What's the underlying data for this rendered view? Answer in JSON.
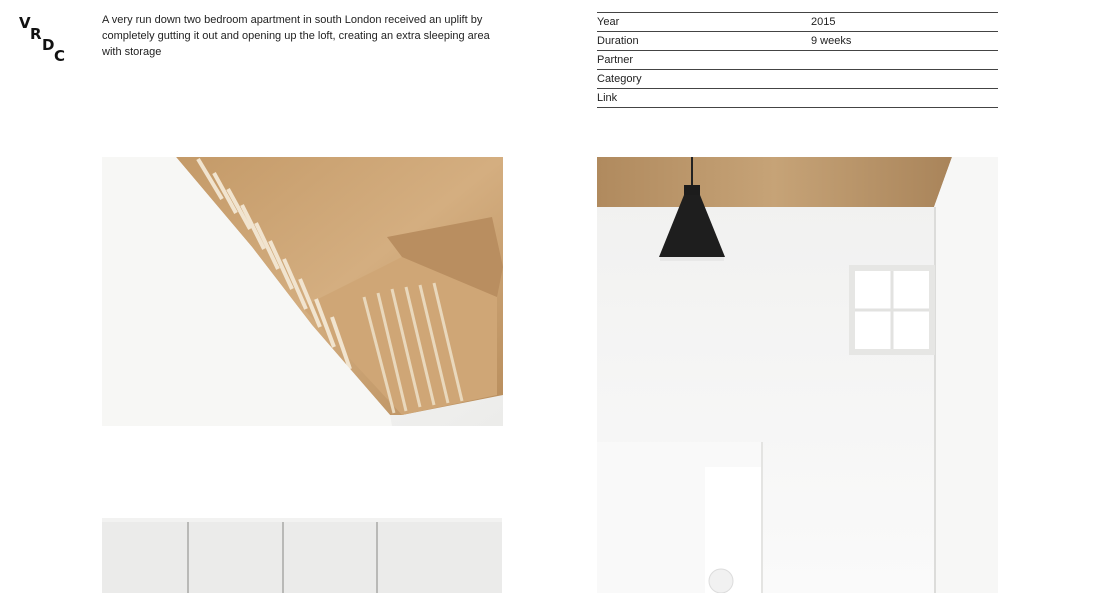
{
  "brand": {
    "logo_letters": [
      "V",
      "R",
      "D",
      "C"
    ]
  },
  "project": {
    "description": "A very run down two bedroom apartment in south London received an uplift by completely gutting it out and opening up the loft, creating an extra sleeping area with storage"
  },
  "meta": [
    {
      "label": "Year",
      "value": "2015"
    },
    {
      "label": "Duration",
      "value": "9 weeks"
    },
    {
      "label": "Partner",
      "value": ""
    },
    {
      "label": "Category",
      "value": ""
    },
    {
      "label": "Link",
      "value": ""
    }
  ],
  "gallery": [
    {
      "subject": "plywood-staircase-photo"
    },
    {
      "subject": "pendant-lamp-loft-photo"
    },
    {
      "subject": "storage-wall-photo"
    }
  ]
}
